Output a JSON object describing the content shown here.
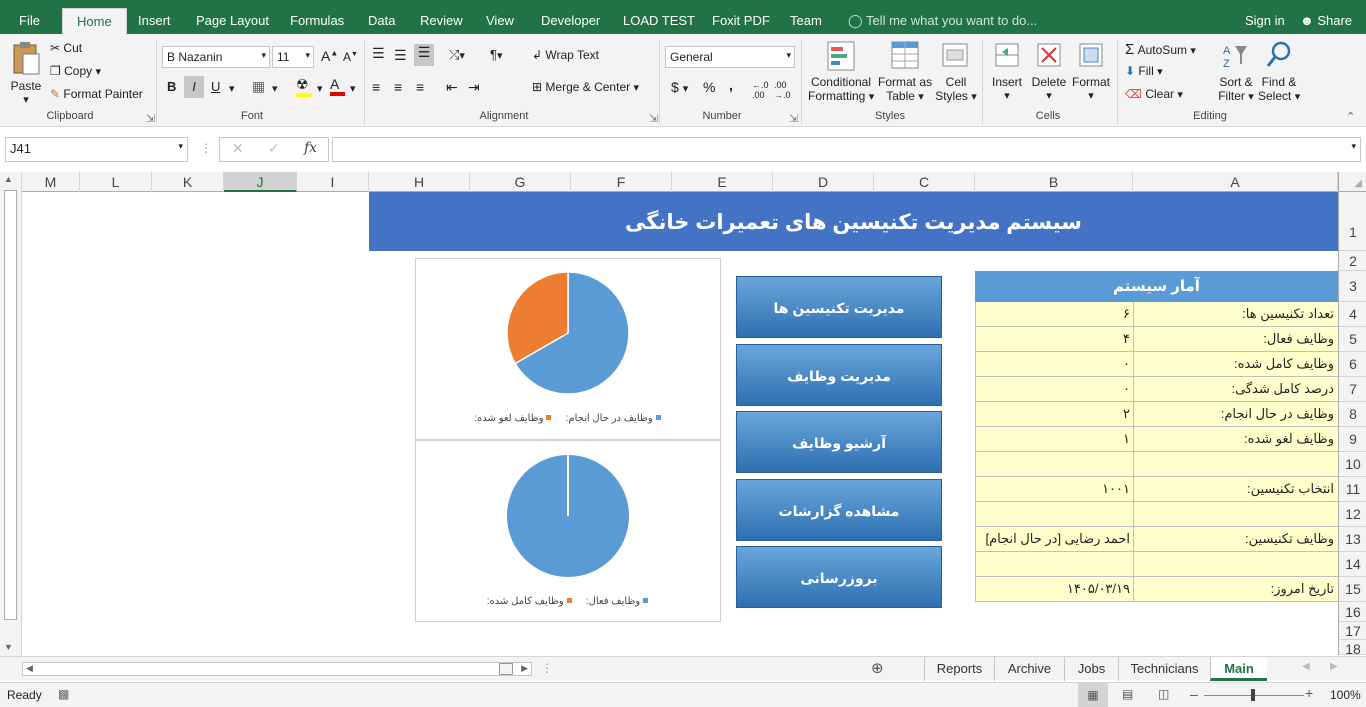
{
  "ribbon_tabs": [
    "File",
    "Home",
    "Insert",
    "Page Layout",
    "Formulas",
    "Data",
    "Review",
    "View",
    "Developer",
    "LOAD TEST",
    "Foxit PDF",
    "Team"
  ],
  "tell_me": "Tell me what you want to do...",
  "sign_in": "Sign in",
  "share": "Share",
  "clipboard": {
    "paste": "Paste",
    "cut": "Cut",
    "copy": "Copy",
    "format_painter": "Format Painter",
    "group": "Clipboard"
  },
  "font": {
    "name": "B Nazanin",
    "size": "11",
    "group": "Font",
    "bold": "B",
    "italic": "I",
    "underline": "U"
  },
  "alignment": {
    "wrap": "Wrap Text",
    "merge": "Merge & Center",
    "group": "Alignment"
  },
  "number": {
    "format": "General",
    "currency": "$",
    "percent": "%",
    "comma": ",",
    "group": "Number"
  },
  "styles": {
    "cond1": "Conditional",
    "cond2": "Formatting",
    "fmt1": "Format as",
    "fmt2": "Table",
    "cell1": "Cell",
    "cell2": "Styles",
    "group": "Styles"
  },
  "cells": {
    "insert": "Insert",
    "delete": "Delete",
    "format": "Format",
    "group": "Cells"
  },
  "editing": {
    "autosum": "AutoSum",
    "fill": "Fill",
    "clear": "Clear",
    "sort1": "Sort &",
    "sort2": "Filter",
    "find1": "Find &",
    "find2": "Select",
    "group": "Editing"
  },
  "name_box": "J41",
  "fx": "fx",
  "columns": [
    "M",
    "L",
    "K",
    "J",
    "I",
    "H",
    "G",
    "F",
    "E",
    "D",
    "C",
    "B",
    "A"
  ],
  "rows": [
    "1",
    "2",
    "3",
    "4",
    "5",
    "6",
    "7",
    "8",
    "9",
    "10",
    "11",
    "12",
    "13",
    "14",
    "15",
    "16",
    "17",
    "18"
  ],
  "sheet": {
    "title": "سیستم مدیریت تکنیسین های تعمیرات خانگی",
    "stats_header": "آمار سیستم",
    "stats": [
      {
        "label": "تعداد تکنیسین ها:",
        "value": "۶"
      },
      {
        "label": "وظایف فعال:",
        "value": "۴"
      },
      {
        "label": "وظایف کامل شده:",
        "value": "۰"
      },
      {
        "label": "درصد کامل شدگی:",
        "value": "۰"
      },
      {
        "label": "وظایف در حال انجام:",
        "value": "۲"
      },
      {
        "label": "وظایف لغو شده:",
        "value": "۱"
      },
      {
        "label": "",
        "value": ""
      },
      {
        "label": "انتخاب تکنیسین:",
        "value": "۱۰۰۱"
      },
      {
        "label": "",
        "value": ""
      },
      {
        "label": "وظایف تکنیسین:",
        "value": "احمد رضایی [در حال انجام]"
      },
      {
        "label": "",
        "value": ""
      },
      {
        "label": "تاریخ امروز:",
        "value": "۱۴۰۵/۰۳/۱۹"
      }
    ],
    "buttons": [
      "مدیریت تکنیسین ها",
      "مدیریت وظایف",
      "آرشیو وظایف",
      "مشاهده گزارشات",
      "بروزرسانی"
    ]
  },
  "chart_data": [
    {
      "type": "pie",
      "series": [
        {
          "values": [
            2,
            1
          ]
        }
      ],
      "categories": [
        "وظایف در حال انجام:",
        "وظایف لغو شده:"
      ],
      "colors": [
        "#5b9bd5",
        "#ed7d31"
      ],
      "legend": "bottom"
    },
    {
      "type": "pie",
      "series": [
        {
          "values": [
            4,
            0
          ]
        }
      ],
      "categories": [
        "وظایف فعال:",
        "وظایف کامل شده:"
      ],
      "colors": [
        "#5b9bd5",
        "#ed7d31"
      ],
      "legend": "bottom"
    }
  ],
  "sheet_tabs": [
    "Reports",
    "Archive",
    "Jobs",
    "Technicians",
    "Main"
  ],
  "active_sheet": "Main",
  "status": {
    "ready": "Ready",
    "zoom": "100%"
  }
}
